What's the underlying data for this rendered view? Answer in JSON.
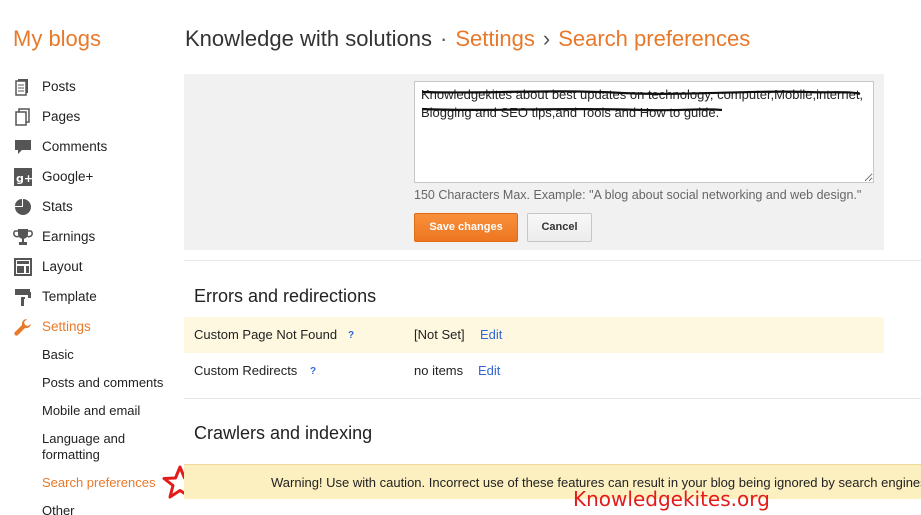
{
  "header": {
    "brand": "My blogs",
    "blog_name": "Knowledge with solutions",
    "sep1": "·",
    "crumb_settings": "Settings",
    "sep2": "›",
    "crumb_search": "Search preferences"
  },
  "sidebar": {
    "items": [
      {
        "label": "Posts",
        "icon": "posts-icon"
      },
      {
        "label": "Pages",
        "icon": "pages-icon"
      },
      {
        "label": "Comments",
        "icon": "comments-icon"
      },
      {
        "label": "Google+",
        "icon": "google-plus-icon"
      },
      {
        "label": "Stats",
        "icon": "stats-icon"
      },
      {
        "label": "Earnings",
        "icon": "earnings-icon"
      },
      {
        "label": "Layout",
        "icon": "layout-icon"
      },
      {
        "label": "Template",
        "icon": "template-icon"
      },
      {
        "label": "Settings",
        "icon": "wrench-icon"
      }
    ],
    "sub_items": [
      {
        "label": "Basic"
      },
      {
        "label": "Posts and comments"
      },
      {
        "label": "Mobile and email"
      },
      {
        "label": "Language and formatting"
      },
      {
        "label": "Search preferences"
      },
      {
        "label": "Other"
      }
    ]
  },
  "description": {
    "text": "Knowledgekites about best updates on technology, computer,Mobile,internet, Blogging and SEO tips,and Tools and How to guide.",
    "hint": "150 Characters Max. Example: \"A blog about social networking and web design.\"",
    "save_label": "Save changes",
    "cancel_label": "Cancel"
  },
  "errors": {
    "title": "Errors and redirections",
    "rows": [
      {
        "label": "Custom Page Not Found",
        "help": "?",
        "value": "[Not Set]",
        "edit": "Edit"
      },
      {
        "label": "Custom Redirects",
        "help": "?",
        "value": "no items",
        "edit": "Edit"
      }
    ]
  },
  "crawlers": {
    "title": "Crawlers and indexing",
    "warning": "Warning! Use with caution. Incorrect use of these features can result in your blog being ignored by search engines."
  },
  "watermark": "Knowledgekites.org",
  "colors": {
    "accent": "#e8792b",
    "link": "#3367d6",
    "warning_bg": "#fcefc0",
    "highlight_row": "#fff8e1",
    "watermark": "#e31b1b"
  }
}
